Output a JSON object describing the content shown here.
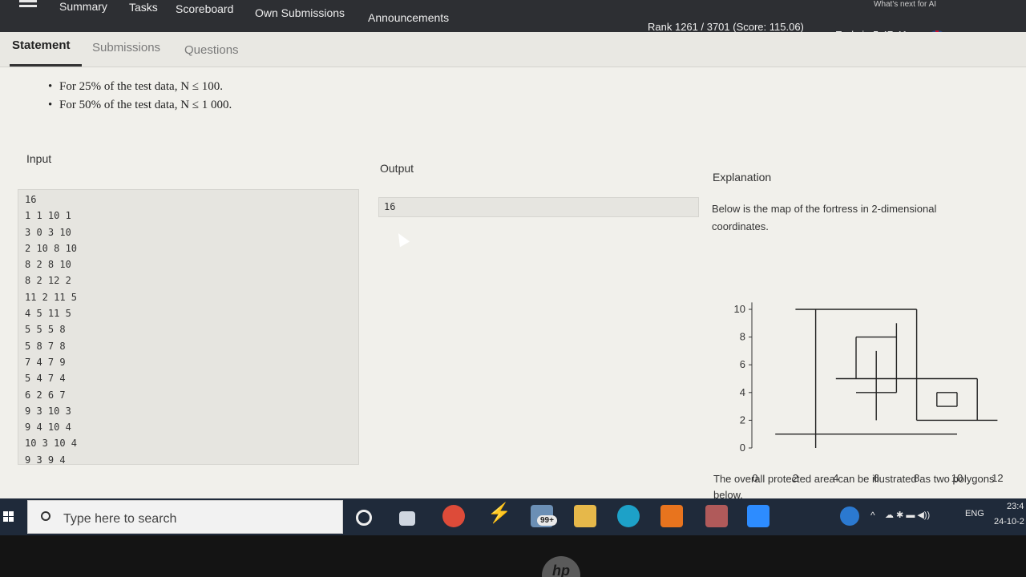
{
  "nav": {
    "items": [
      "Summary",
      "Tasks",
      "Scoreboard",
      "Own Submissions",
      "Announcements"
    ],
    "rank": "Rank 1261 / 3701 (Score: 115.06)",
    "ends": "Ends in 5:47:41",
    "corner_note": "What's next for AI"
  },
  "tabs": [
    "Statement",
    "Submissions",
    "Questions"
  ],
  "constraints": [
    "For 25% of the test data, N ≤ 100.",
    "For 50% of the test data, N ≤ 1 000."
  ],
  "sample": {
    "input_title": "Input",
    "output_title": "Output",
    "explanation_title": "Explanation",
    "input_lines": [
      "16",
      "1 1 10 1",
      "3 0 3 10",
      "2 10 8 10",
      "8 2 8 10",
      "8 2 12 2",
      "11 2 11 5",
      "4 5 11 5",
      "5 5 5 8",
      "5 8 7 8",
      "7 4 7 9",
      "5 4 7 4",
      "6 2 6 7",
      "9 3 10 3",
      "9 4 10 4",
      "10 3 10 4",
      "9 3 9 4"
    ],
    "output": "16",
    "explanation_text": "Below is the map of the fortress in 2-dimensional coordinates.",
    "explanation_bottom": "The overall protected area can be illustrated as two polygons below."
  },
  "plot": {
    "x_ticks": [
      "0",
      "2",
      "4",
      "6",
      "8",
      "10",
      "12"
    ],
    "y_ticks": [
      "0",
      "2",
      "4",
      "6",
      "8",
      "10"
    ]
  },
  "taskbar": {
    "search_placeholder": "Type here to search",
    "badge": "99+",
    "lang": "ENG",
    "time": "23:4",
    "date": "24-10-2"
  },
  "colors": {
    "nav_bg": "#2d2f33",
    "content_bg": "#f1f0eb",
    "taskbar_bg": "#1f2a3a"
  }
}
